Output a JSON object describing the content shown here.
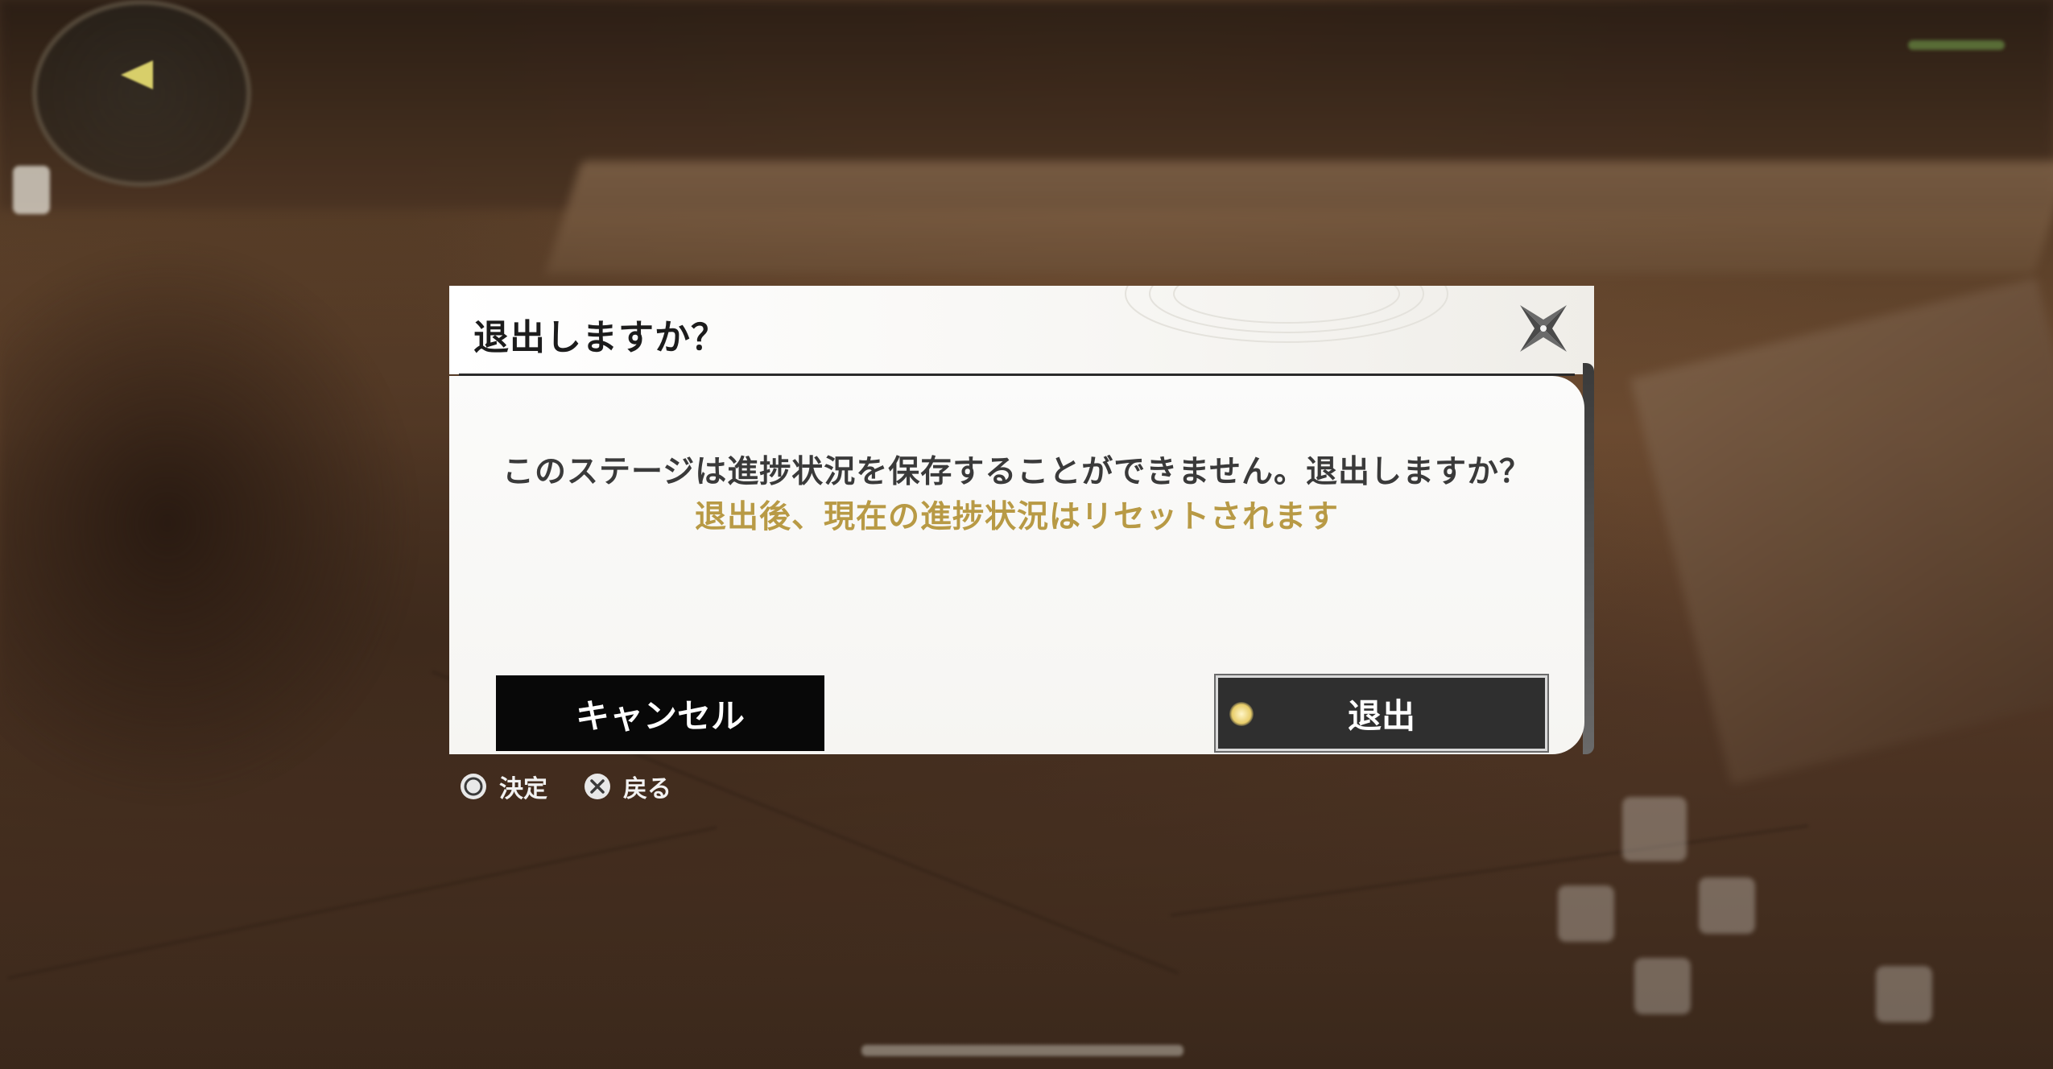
{
  "dialog": {
    "title": "退出しますか？",
    "message": "このステージは進捗状況を保存することができません。退出しますか？",
    "warning": "退出後、現在の進捗状況はリセットされます",
    "cancel_label": "キャンセル",
    "exit_label": "退出",
    "focused_button": "exit"
  },
  "prompts": [
    {
      "icon": "circle-button-icon",
      "label": "決定"
    },
    {
      "icon": "cross-button-icon",
      "label": "戻る"
    }
  ],
  "colors": {
    "warning_text": "#b89a45",
    "cancel_button_bg": "#080808",
    "exit_button_bg": "#2f2f2f",
    "focus_dot": "#e8cd6a"
  }
}
